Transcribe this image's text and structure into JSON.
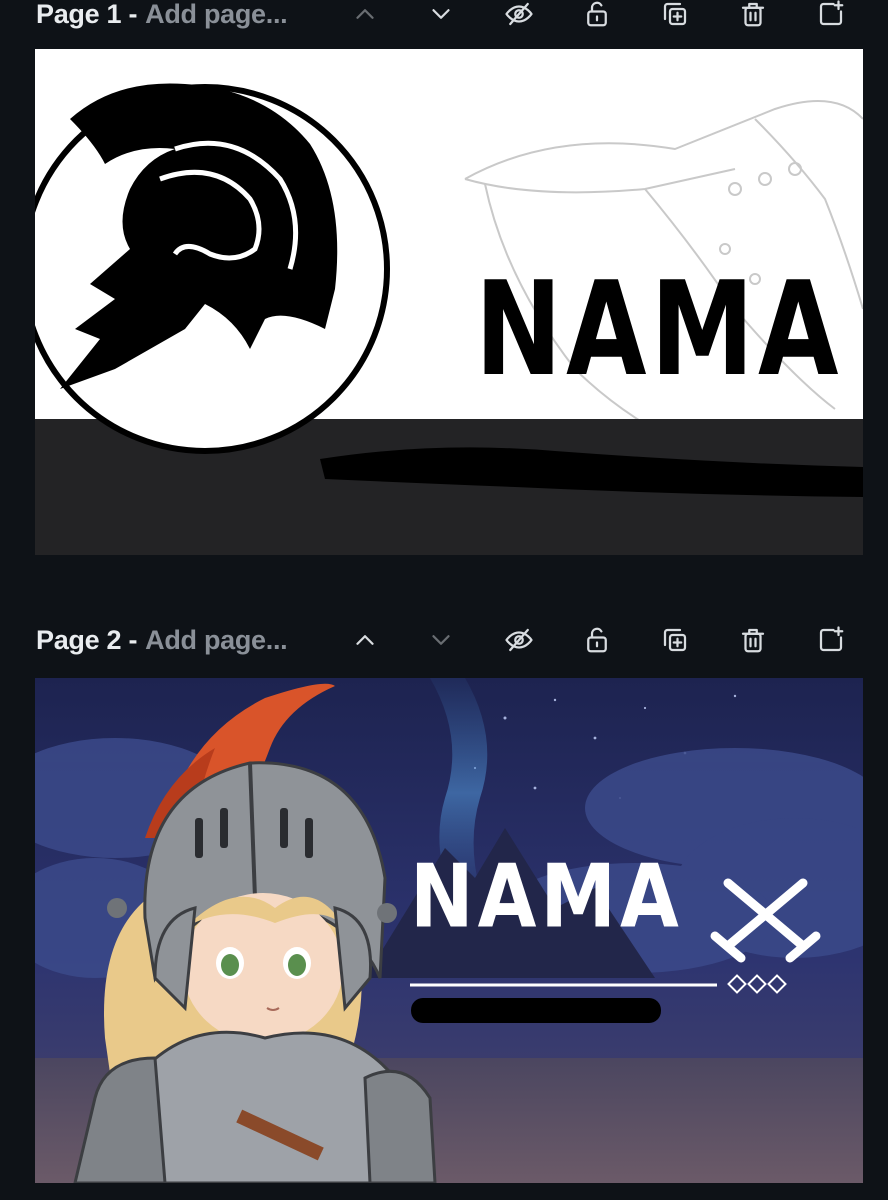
{
  "pages": [
    {
      "number_label": "Page 1 -",
      "add_title_placeholder": "Add page...",
      "brand_text": "NAMA",
      "theme": {
        "background": "#ffffff",
        "band": "#232325",
        "ink": "#000000"
      }
    },
    {
      "number_label": "Page 2 -",
      "add_title_placeholder": "Add page...",
      "brand_text": "NAMA",
      "theme": {
        "sky": "#2b3366",
        "ink": "#ffffff",
        "accent": "#d9542a"
      }
    }
  ],
  "toolbar": {
    "icons": [
      "move-up-icon",
      "move-down-icon",
      "hide-page-icon",
      "lock-page-icon",
      "duplicate-page-icon",
      "delete-page-icon",
      "add-page-icon"
    ]
  },
  "colors": {
    "app_background": "#0e1217",
    "text_primary": "#e9ecef",
    "text_muted": "#8a9098"
  }
}
